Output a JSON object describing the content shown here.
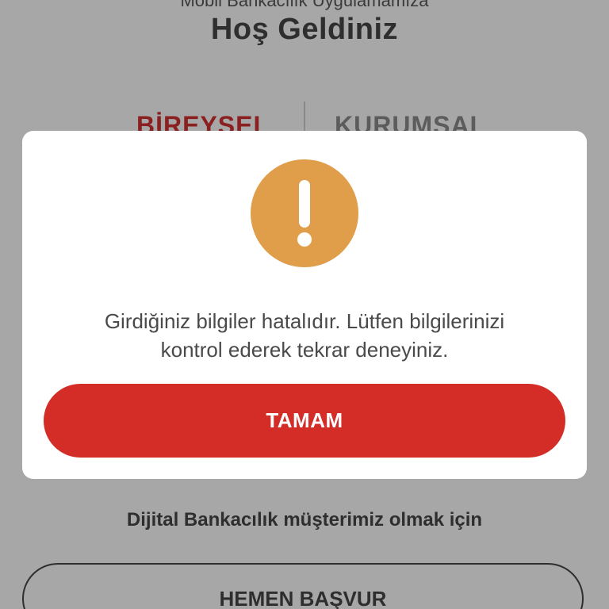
{
  "background": {
    "subtitle": "Mobil Bankacılık Uygulamamıza",
    "welcome_title": "Hoş Geldiniz",
    "tabs": [
      {
        "label": "BİREYSEL",
        "active": true
      },
      {
        "label": "KURUMSAL",
        "active": false
      }
    ],
    "digital_text": "Dijital Bankacılık müşterimiz olmak için",
    "apply_button_label": "HEMEN BAŞVUR"
  },
  "dialog": {
    "icon": "warning-exclamation-icon",
    "message_lines": [
      "Girdiğiniz bilgiler hatalıdır. Lütfen bilgilerinizi",
      "kontrol ederek tekrar deneyiniz."
    ],
    "ok_button_label": "TAMAM"
  },
  "colors": {
    "accent_red": "#d42d27",
    "warning_orange": "#e09d4a",
    "overlay_gray": "#a7a7a7"
  }
}
